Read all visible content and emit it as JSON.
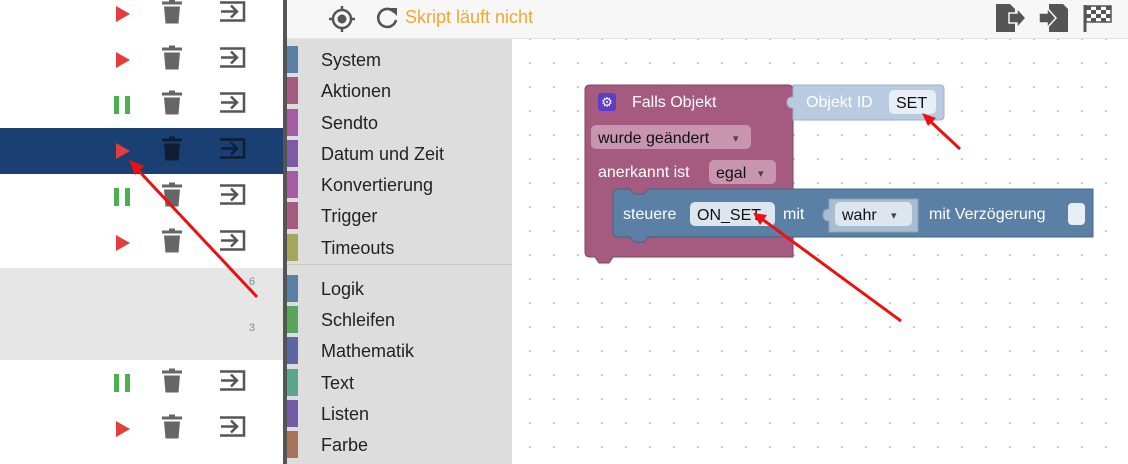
{
  "left_rows": [
    {
      "state": "play",
      "selected": false,
      "gray": false,
      "num": ""
    },
    {
      "state": "play",
      "selected": false,
      "gray": false,
      "num": ""
    },
    {
      "state": "pause",
      "selected": false,
      "gray": false,
      "num": ""
    },
    {
      "state": "play",
      "selected": true,
      "gray": false,
      "num": ""
    },
    {
      "state": "pause",
      "selected": false,
      "gray": false,
      "num": ""
    },
    {
      "state": "play",
      "selected": false,
      "gray": false,
      "num": ""
    },
    {
      "state": "none",
      "selected": false,
      "gray": true,
      "num": "6"
    },
    {
      "state": "none",
      "selected": false,
      "gray": true,
      "num": "3"
    },
    {
      "state": "pause",
      "selected": false,
      "gray": false,
      "num": ""
    },
    {
      "state": "play",
      "selected": false,
      "gray": false,
      "num": ""
    }
  ],
  "toolbar": {
    "status": "Skript läuft nicht",
    "status_color": "#f0a830"
  },
  "toolbox": {
    "categories": [
      {
        "label": "System",
        "color": "#5b80a5"
      },
      {
        "label": "Aktionen",
        "color": "#a55b80"
      },
      {
        "label": "Sendto",
        "color": "#a55ba5"
      },
      {
        "label": "Datum und Zeit",
        "color": "#805ba5"
      },
      {
        "label": "Konvertierung",
        "color": "#a55ba5"
      },
      {
        "label": "Trigger",
        "color": "#a55b80"
      },
      {
        "label": "Timeouts",
        "color": "#a5a55b"
      },
      {
        "label": "Logik",
        "color": "#5b80a5"
      },
      {
        "label": "Schleifen",
        "color": "#5ba55b"
      },
      {
        "label": "Mathematik",
        "color": "#5b67a5"
      },
      {
        "label": "Text",
        "color": "#5ba58c"
      },
      {
        "label": "Listen",
        "color": "#745ba5"
      },
      {
        "label": "Farbe",
        "color": "#a5745b"
      }
    ]
  },
  "blocks": {
    "trigger_title": "Falls Objekt",
    "trigger_mode": "wurde geändert",
    "ack_label": "anerkannt ist",
    "ack_value": "egal",
    "objid_label": "Objekt ID",
    "objid_value": "SET",
    "control_label": "steuere",
    "control_target": "ON_SET",
    "control_mit": "mit",
    "value_select": "wahr",
    "delay_label": "mit Verzögerung",
    "dropdown_arrow": "▾"
  }
}
